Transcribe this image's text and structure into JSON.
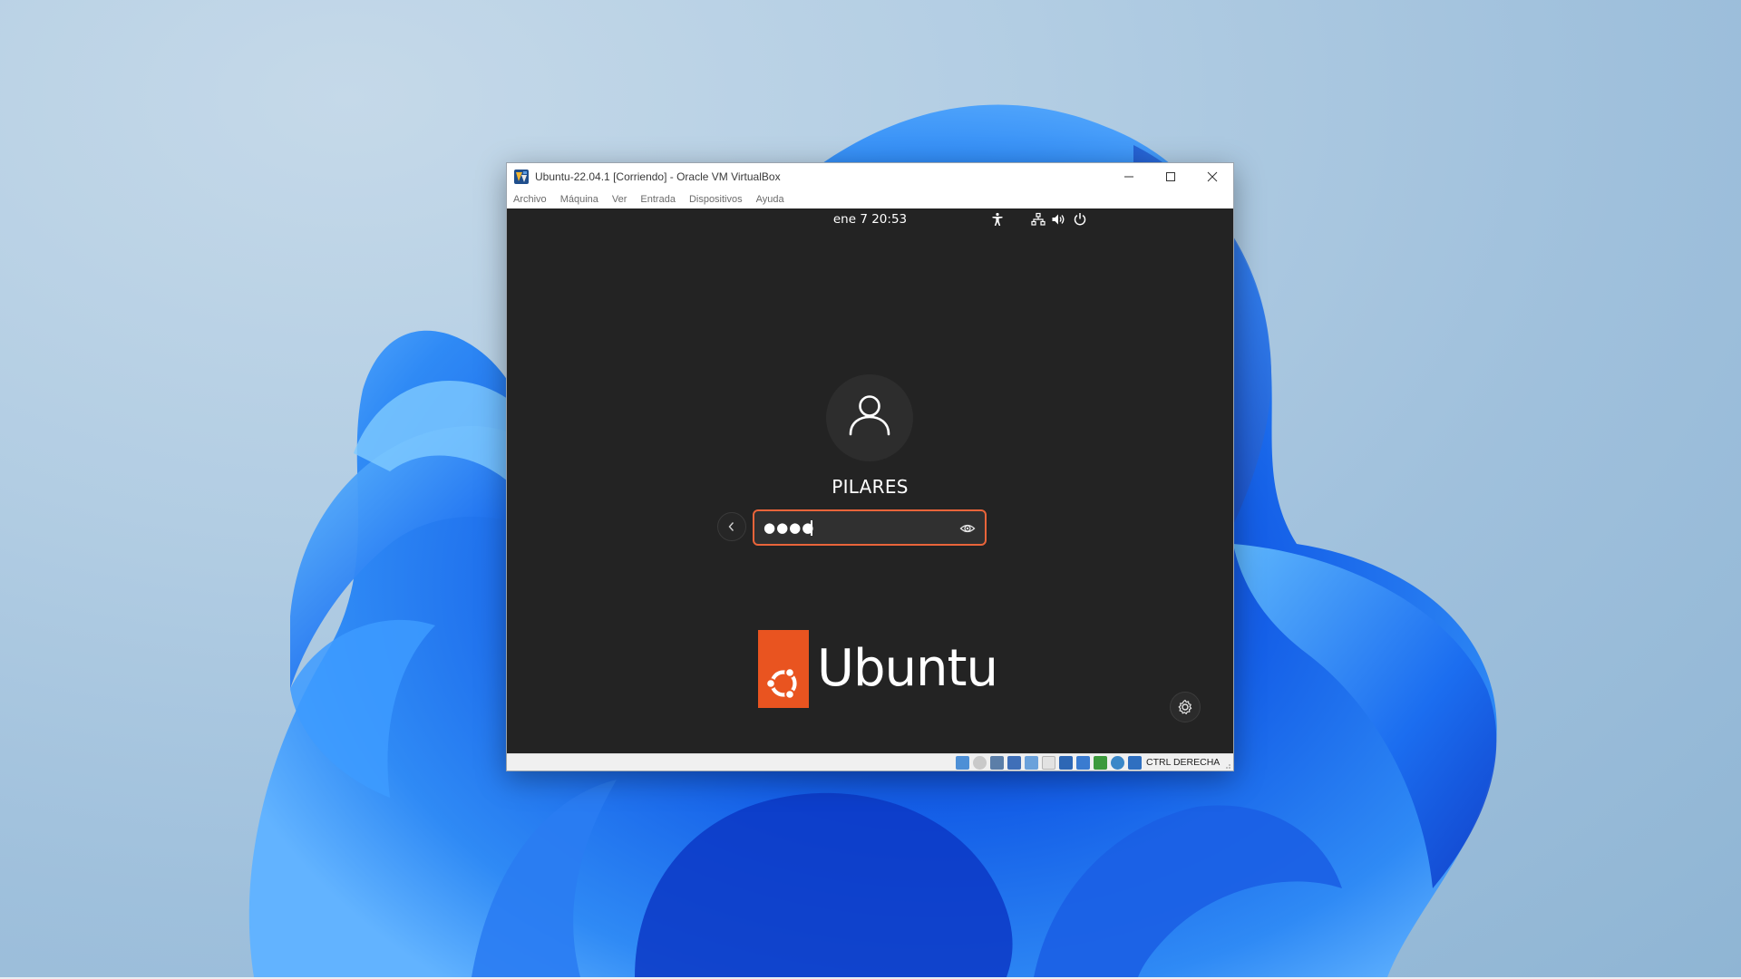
{
  "window": {
    "title": "Ubuntu-22.04.1 [Corriendo] - Oracle VM VirtualBox",
    "controls": [
      "minimize",
      "maximize",
      "close"
    ]
  },
  "menubar": {
    "items": [
      "Archivo",
      "Máquina",
      "Ver",
      "Entrada",
      "Dispositivos",
      "Ayuda"
    ]
  },
  "vm": {
    "topbar": {
      "clock": "ene 7  20:53",
      "icons": [
        "accessibility-icon",
        "network-icon",
        "volume-icon",
        "power-icon"
      ]
    },
    "login": {
      "username": "PILARES",
      "password_mask": "●●●●",
      "reveal_icon": "eye-icon",
      "back_icon": "chevron-left-icon"
    },
    "branding": {
      "wordmark": "Ubuntu",
      "logo_color": "#e95420"
    },
    "settings_icon": "gear-icon"
  },
  "statusbar": {
    "host_key": "CTRL DERECHA",
    "icons": [
      "hard-disk-icon",
      "optical-drive-icon",
      "audio-icon",
      "network-adapter-icon",
      "usb-icon",
      "shared-folders-icon",
      "display-icon",
      "video-capture-icon",
      "recording-icon",
      "cpu-icon",
      "mouse-integration-icon",
      "keyboard-capture-icon"
    ]
  },
  "colors": {
    "accent": "#e95420",
    "vm_background": "#232323",
    "focus_border": "#e9643a"
  }
}
